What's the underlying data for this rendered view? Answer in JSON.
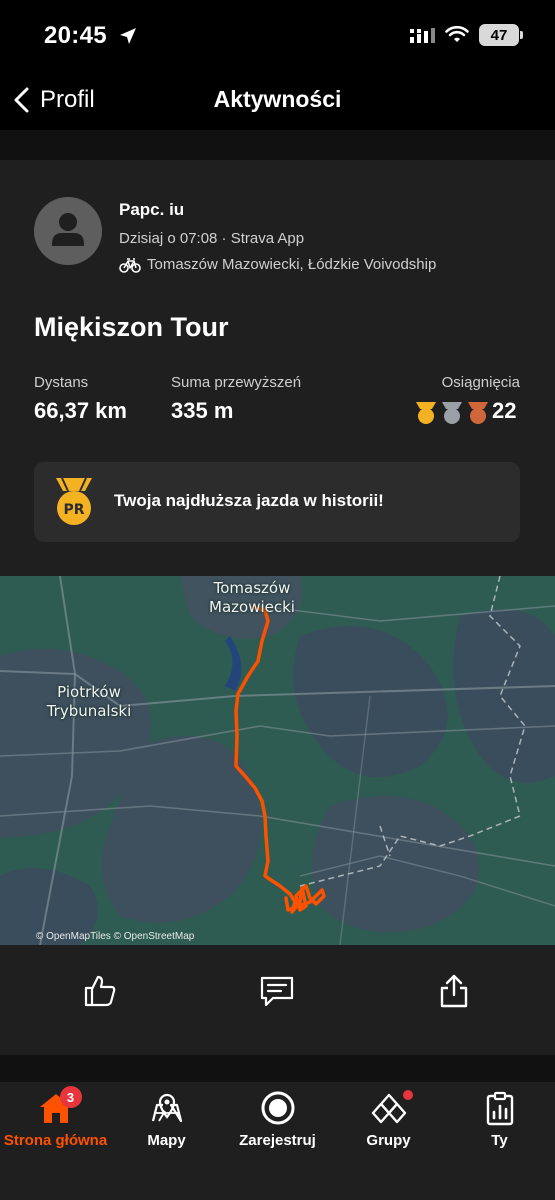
{
  "status_bar": {
    "time": "20:45",
    "battery": "47"
  },
  "nav": {
    "back_label": "Profil",
    "title": "Aktywności"
  },
  "activity": {
    "author": "Papc. iu",
    "meta": "Dzisiaj o 07:08 · Strava App",
    "location": "Tomaszów Mazowiecki, Łódzkie Voivodship",
    "title": "Miękiszon Tour",
    "stats": [
      {
        "label": "Dystans",
        "value": "66,37 km"
      },
      {
        "label": "Suma przewyższeń",
        "value": "335 m"
      }
    ],
    "achievements": {
      "label": "Osiągnięcia",
      "value": "22"
    },
    "pr_banner": {
      "badge": "PR",
      "text": "Twoja najdłuższa jazda w historii!"
    }
  },
  "map": {
    "labels": {
      "tomaszow_line1": "Tomaszów",
      "tomaszow_line2": "Mazowiecki",
      "piotrkow_line1": "Piotrków",
      "piotrkow_line2": "Trybunalski"
    },
    "credit": "© OpenMapTiles © OpenStreetMap",
    "route_color": "#fc5200"
  },
  "actions": {
    "kudos_icon": "thumbs-up-icon",
    "comment_icon": "comment-icon",
    "share_icon": "share-icon"
  },
  "tab_bar": {
    "tabs": [
      {
        "label": "Strona główna",
        "icon": "home-icon",
        "badge": "3",
        "active": true
      },
      {
        "label": "Mapy",
        "icon": "map-icon"
      },
      {
        "label": "Zarejestruj",
        "icon": "record-icon"
      },
      {
        "label": "Grupy",
        "icon": "groups-icon",
        "has_dot": true
      },
      {
        "label": "Ty",
        "icon": "profile-clipboard-icon"
      }
    ]
  },
  "colors": {
    "accent": "#fc5200",
    "gold": "#f4b223",
    "silver": "#9aa0a6",
    "bronze": "#d0673a"
  }
}
